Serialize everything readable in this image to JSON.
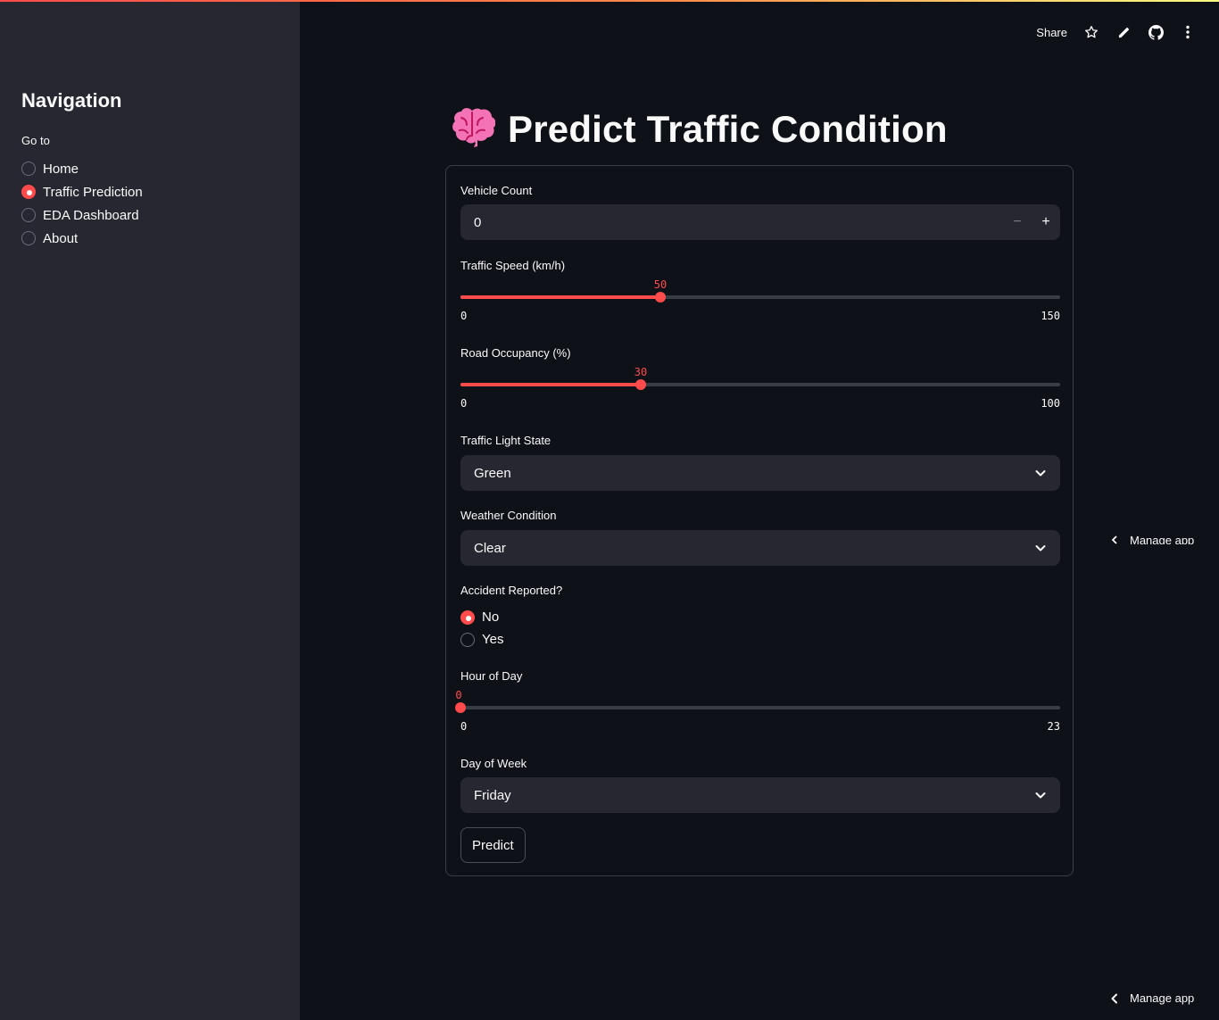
{
  "sidebar": {
    "title": "Navigation",
    "goto_label": "Go to",
    "items": [
      {
        "label": "Home",
        "selected": false
      },
      {
        "label": "Traffic Prediction",
        "selected": true
      },
      {
        "label": "EDA Dashboard",
        "selected": false
      },
      {
        "label": "About",
        "selected": false
      }
    ]
  },
  "toolbar": {
    "share_label": "Share",
    "icons": [
      "star-icon",
      "edit-icon",
      "github-icon",
      "more-vertical-icon"
    ]
  },
  "main": {
    "title_emoji": "🧠",
    "title": "Predict Traffic Condition",
    "vehicle_count": {
      "label": "Vehicle Count",
      "value": "0",
      "minus": "−",
      "plus": "+"
    },
    "traffic_speed": {
      "label": "Traffic Speed (km/h)",
      "value": "50",
      "min": "0",
      "max": "150"
    },
    "road_occupancy": {
      "label": "Road Occupancy (%)",
      "value": "30",
      "min": "0",
      "max": "100"
    },
    "traffic_light": {
      "label": "Traffic Light State",
      "selected": "Green"
    },
    "weather": {
      "label": "Weather Condition",
      "selected": "Clear"
    },
    "accident": {
      "label": "Accident Reported?",
      "options": [
        {
          "label": "No",
          "selected": true
        },
        {
          "label": "Yes",
          "selected": false
        }
      ]
    },
    "hour_of_day": {
      "label": "Hour of Day",
      "value": "0",
      "min": "0",
      "max": "23"
    },
    "day_of_week": {
      "label": "Day of Week",
      "selected": "Friday"
    },
    "predict_label": "Predict"
  },
  "manage_app_label": "Manage app",
  "colors": {
    "accent": "#ff4b4b",
    "background": "#0e1117",
    "sidebar": "#262730",
    "input": "#262730"
  }
}
